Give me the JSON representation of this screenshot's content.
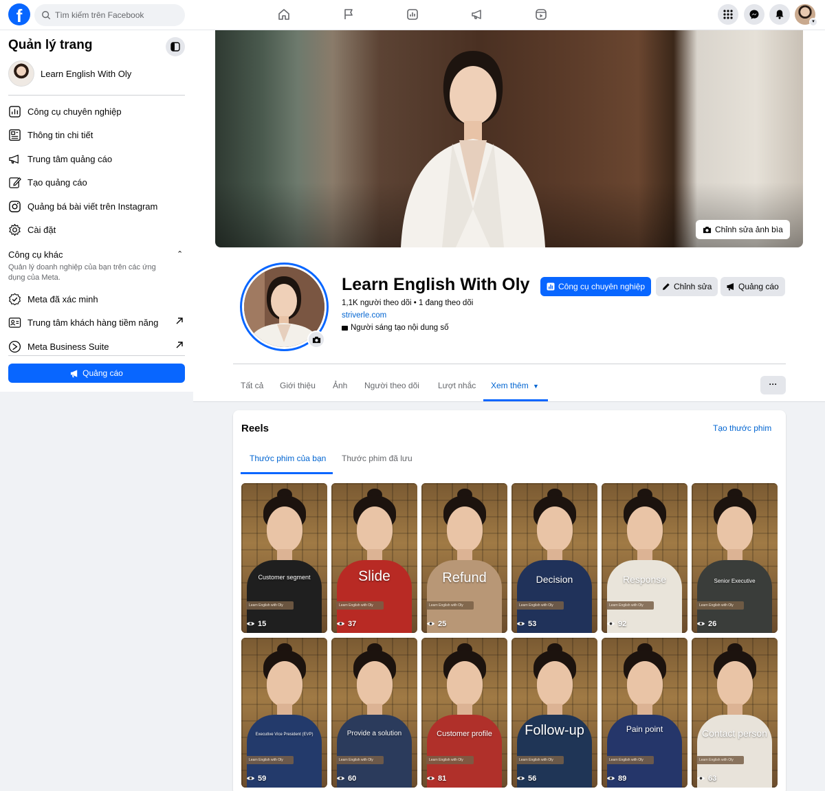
{
  "topbar": {
    "logo": "f",
    "search_placeholder": "Tìm kiếm trên Facebook",
    "nav_icons": [
      "home-icon",
      "flag-icon",
      "insights-icon",
      "megaphone-icon",
      "reels-icon"
    ],
    "right_icons": [
      "menu-grid-icon",
      "messenger-icon",
      "bell-icon"
    ]
  },
  "sidebar": {
    "title": "Quản lý trang",
    "page_name": "Learn English With Oly",
    "items": [
      {
        "label": "Công cụ chuyên nghiệp",
        "icon": "dashboard-icon"
      },
      {
        "label": "Thông tin chi tiết",
        "icon": "insights-icon"
      },
      {
        "label": "Trung tâm quảng cáo",
        "icon": "megaphone-icon"
      },
      {
        "label": "Tạo quảng cáo",
        "icon": "edit-icon"
      },
      {
        "label": "Quảng bá bài viết trên Instagram",
        "icon": "instagram-icon"
      },
      {
        "label": "Cài đặt",
        "icon": "gear-icon"
      }
    ],
    "section_title": "Công cụ khác",
    "section_desc": "Quản lý doanh nghiệp của bạn trên các ứng dụng của Meta.",
    "other_items": [
      {
        "label": "Meta đã xác minh",
        "icon": "verified-icon"
      },
      {
        "label": "Trung tâm khách hàng tiềm năng",
        "icon": "leads-icon"
      },
      {
        "label": "Meta Business Suite",
        "icon": "business-suite-icon"
      }
    ],
    "ad_button": "Quảng cáo"
  },
  "header": {
    "cover_button": "Chỉnh sửa ảnh bìa",
    "page_name": "Learn English With Oly",
    "followers": "1,1K người theo dõi • 1 đang theo dõi",
    "website": "striverle.com",
    "category": "Người sáng tạo nội dung số",
    "buttons": {
      "pro_tools": "Công cụ chuyên nghiệp",
      "edit": "Chỉnh sửa",
      "ads": "Quảng cáo"
    },
    "tabs": [
      "Tất cả",
      "Giới thiệu",
      "Ảnh",
      "Người theo dõi",
      "Lượt nhắc",
      "Xem thêm"
    ],
    "more_button": "···"
  },
  "reels": {
    "title": "Reels",
    "create_link": "Tạo thước phim",
    "subtabs": [
      "Thước phim của bạn",
      "Thước phim đã lưu"
    ],
    "tag": "Learn English with Oly",
    "items": [
      {
        "word": "Customer segment",
        "views": "15",
        "color": "#1f1f1f"
      },
      {
        "word": "Slide",
        "views": "37",
        "color": "#b82a24"
      },
      {
        "word": "Refund",
        "views": "25",
        "color": "#b89776"
      },
      {
        "word": "Decision",
        "views": "53",
        "color": "#20325a"
      },
      {
        "word": "Response",
        "views": "92",
        "color": "#e9e4da"
      },
      {
        "word": "Senior Executive",
        "views": "26",
        "color": "#3a3d3a"
      },
      {
        "word": "Executive Vice President (EVP)",
        "views": "59",
        "color": "#233a6b"
      },
      {
        "word": "Provide a solution",
        "views": "60",
        "color": "#2b3b5c"
      },
      {
        "word": "Customer profile",
        "views": "81",
        "color": "#b0302a"
      },
      {
        "word": "Follow-up",
        "views": "56",
        "color": "#1f3556"
      },
      {
        "word": "Pain point",
        "views": "89",
        "color": "#25366a"
      },
      {
        "word": "Contact person",
        "views": "63",
        "color": "#e8e3da"
      }
    ]
  }
}
